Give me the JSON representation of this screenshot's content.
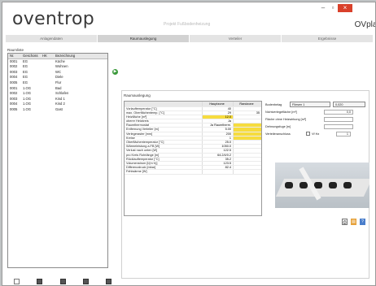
{
  "window": {
    "logo": "oventrop",
    "project_title": "Projekt Fußbodenheizung",
    "app_name": "OVplan",
    "minimize": "–",
    "maximize": "▫",
    "close": "×"
  },
  "tabs": [
    {
      "label": "Anlagendaten",
      "active": false
    },
    {
      "label": "Raumauslegung",
      "active": true
    },
    {
      "label": "Verteiler",
      "active": false
    },
    {
      "label": "Ergebnisse",
      "active": false
    }
  ],
  "rooms": {
    "title": "Raumliste",
    "columns": [
      "Nr.",
      "Geschoss",
      "HK",
      "Bezeichnung"
    ],
    "rows": [
      [
        "0001",
        "EG",
        "",
        "Küche"
      ],
      [
        "0002",
        "EG",
        "",
        "Wohnen"
      ],
      [
        "0003",
        "EG",
        "",
        "WC"
      ],
      [
        "0004",
        "EG",
        "",
        "Diele"
      ],
      [
        "0005",
        "EG",
        "",
        "Flur"
      ],
      [
        "0001",
        "1.OG",
        "",
        "Bad"
      ],
      [
        "0002",
        "1.OG",
        "",
        "Schlafen"
      ],
      [
        "0003",
        "1.OG",
        "",
        "Kind 1"
      ],
      [
        "0004",
        "1.OG",
        "",
        "Kind 2"
      ],
      [
        "0005",
        "1.OG",
        "",
        "Gast"
      ]
    ]
  },
  "calc": {
    "title": "Raumauslegung",
    "col_a": "Hauptzone",
    "col_b": "Randzone",
    "rows": [
      {
        "label": "Vorlauftemperatur [°C]",
        "a": "40",
        "b": "",
        "ya": false,
        "yb": false
      },
      {
        "label": "max. Oberflächentemp. [°C]",
        "a": "29",
        "b": "35",
        "ya": false,
        "yb": false
      },
      {
        "label": "Heizfläche [m²]",
        "a": "12.0",
        "b": "",
        "ya": true,
        "yb": false
      },
      {
        "label": "oberer Heizkreis",
        "a": "Ja",
        "b": "",
        "ya": false,
        "yb": false
      },
      {
        "label": "Raumthermostat",
        "a": "Ja Raumtherm.",
        "b": "",
        "ya": false,
        "yb": true
      },
      {
        "label": "Entfernung Verteiler [m]",
        "a": "5.00",
        "b": "",
        "ya": false,
        "yb": true
      },
      {
        "label": "Verlegeraster [mm]",
        "a": "200",
        "b": "",
        "ya": false,
        "yb": true
      },
      {
        "label": "Kreise",
        "a": "1",
        "b": "",
        "ya": false,
        "yb": true
      },
      {
        "label": "Oberflächentemperatur [°C]",
        "a": "25.0",
        "b": "",
        "ya": false,
        "yb": false
      },
      {
        "label": "Wärmeleistung a.FB [W]",
        "a": "1050.0",
        "b": "",
        "ya": false,
        "yb": false
      },
      {
        "label": "Verlust nach unten [W]",
        "a": "122.5",
        "b": "",
        "ya": false,
        "yb": false
      },
      {
        "label": "pro Kreis Rohrlänge [m]",
        "a": "64.2/4/0.2",
        "b": "",
        "ya": false,
        "yb": false
      },
      {
        "label": "Rücklauftemperatur [°C]",
        "a": "35.2",
        "b": "",
        "ya": false,
        "yb": false
      },
      {
        "label": "Volumenstrom [l/(m·h)]",
        "a": "123.5",
        "b": "",
        "ya": false,
        "yb": false
      },
      {
        "label": "Differenzdruck [mbar]",
        "a": "82.4",
        "b": "",
        "ya": false,
        "yb": false
      },
      {
        "label": "Fehlwärme [W]",
        "a": "",
        "b": "",
        "ya": false,
        "yb": false
      }
    ]
  },
  "side": {
    "floor_label": "Bodenbelag",
    "floor_value": "Fliesen 1",
    "floor_r": "0,020",
    "rows": [
      {
        "label": "Nichtverlegefläche [m²]",
        "value": "0,0"
      },
      {
        "label": "Fläche ohne Heizwirkung [m²]",
        "value": ""
      },
      {
        "label": "Dehnungsfuge [m]",
        "value": ""
      }
    ],
    "connection_label": "Verteileranschluss",
    "connection_check": "Vf Hz",
    "connection_value": "1"
  },
  "icons": {
    "go": "▶",
    "print": "⎙",
    "doc": "▤",
    "help": "?"
  }
}
